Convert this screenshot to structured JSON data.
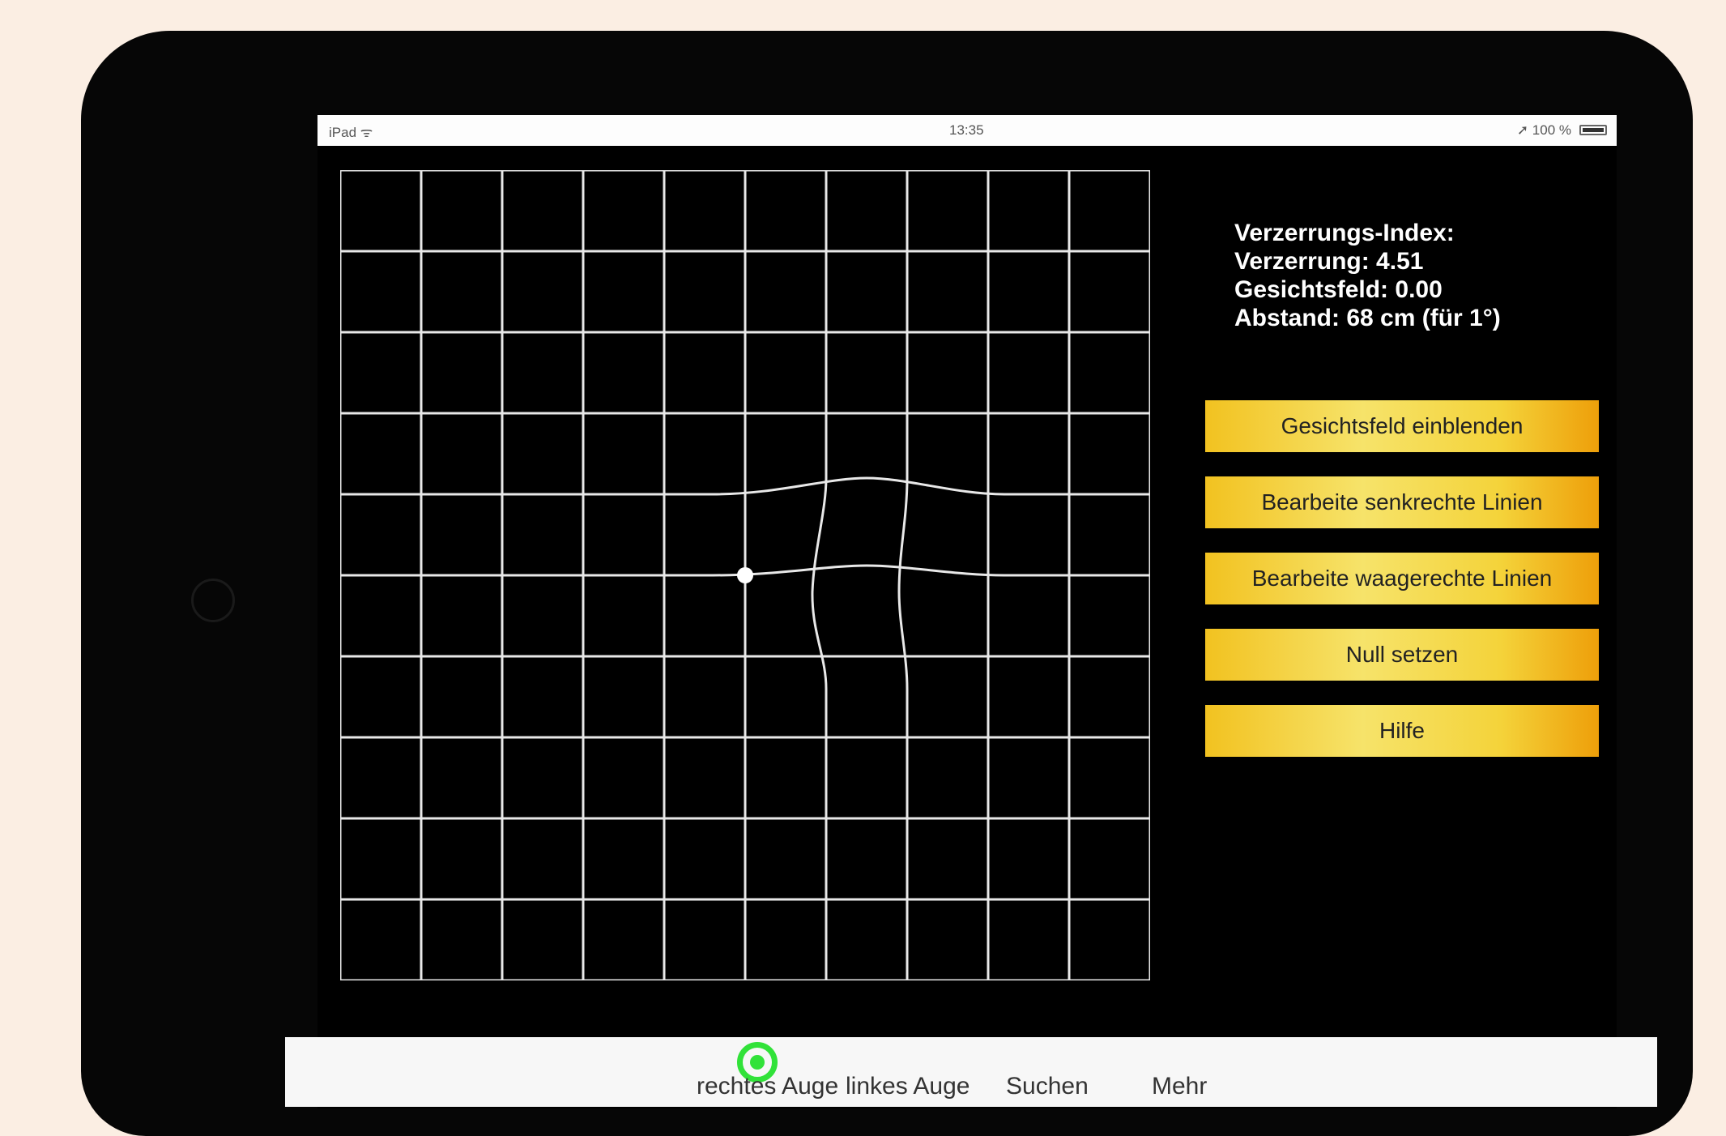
{
  "status_bar": {
    "carrier": "iPad ᯤ",
    "time": "13:35",
    "battery": "➚ 100 %"
  },
  "info": {
    "title": "Verzerrungs-Index:",
    "distortion": "Verzerrung: 4.51",
    "field_of_view": "Gesichtsfeld: 0.00",
    "distance": "Abstand: 68 cm (für 1°)"
  },
  "buttons": {
    "show_field": "Gesichtsfeld einblenden",
    "edit_vertical": "Bearbeite senkrechte Linien",
    "edit_horizontal": "Bearbeite waagerechte Linien",
    "reset": "Null setzen",
    "help": "Hilfe"
  },
  "tabs": [
    {
      "label": "rechtes Auge",
      "icon": "eye-target-icon",
      "active": true
    },
    {
      "label": "linkes Auge"
    },
    {
      "label": "Suchen"
    },
    {
      "label": "Mehr"
    }
  ],
  "grid": {
    "columns": 10,
    "rows": 10,
    "line_color": "#e8e8e8",
    "fixation_point_color": "#ffffff"
  },
  "colors": {
    "button_yellow": "#f4d33a",
    "tab_active_green": "#31e239"
  }
}
